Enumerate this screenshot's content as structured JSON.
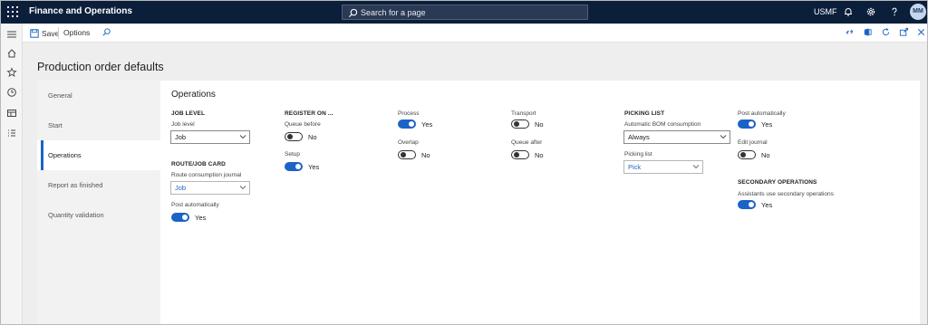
{
  "app": {
    "title": "Finance and Operations",
    "search_placeholder": "Search for a page",
    "company": "USMF",
    "user_initials": "MM"
  },
  "toolbar": {
    "save_label": "Save",
    "options_label": "Options"
  },
  "page": {
    "title": "Production order defaults"
  },
  "tabs": [
    {
      "label": "General"
    },
    {
      "label": "Start"
    },
    {
      "label": "Operations",
      "active": true
    },
    {
      "label": "Report as finished"
    },
    {
      "label": "Quantity validation"
    }
  ],
  "section": {
    "title": "Operations",
    "job_level": {
      "group": "JOB LEVEL",
      "label": "Job level",
      "value": "Job"
    },
    "route_job_card": {
      "group": "ROUTE/JOB CARD",
      "journal_label": "Route consumption journal",
      "journal_value": "Job",
      "post_label": "Post automatically",
      "post_value": "Yes"
    },
    "register_on": {
      "group": "REGISTER ON ...",
      "queue_before_label": "Queue before",
      "queue_before_value": "No",
      "setup_label": "Setup",
      "setup_value": "Yes"
    },
    "process": {
      "label": "Process",
      "value": "Yes"
    },
    "overlap": {
      "label": "Overlap",
      "value": "No"
    },
    "transport": {
      "label": "Transport",
      "value": "No"
    },
    "queue_after": {
      "label": "Queue after",
      "value": "No"
    },
    "picking_list": {
      "group": "PICKING LIST",
      "bom_label": "Automatic BOM consumption",
      "bom_value": "Always",
      "pick_label": "Picking list",
      "pick_value": "Pick"
    },
    "post_automatically": {
      "label": "Post automatically",
      "value": "Yes"
    },
    "edit_journal": {
      "label": "Edit journal",
      "value": "No"
    },
    "secondary": {
      "group": "SECONDARY OPERATIONS",
      "label": "Assistants use secondary operations",
      "value": "Yes"
    }
  },
  "colors": {
    "topbar": "#0b1f3b",
    "accent": "#1b63c6"
  }
}
